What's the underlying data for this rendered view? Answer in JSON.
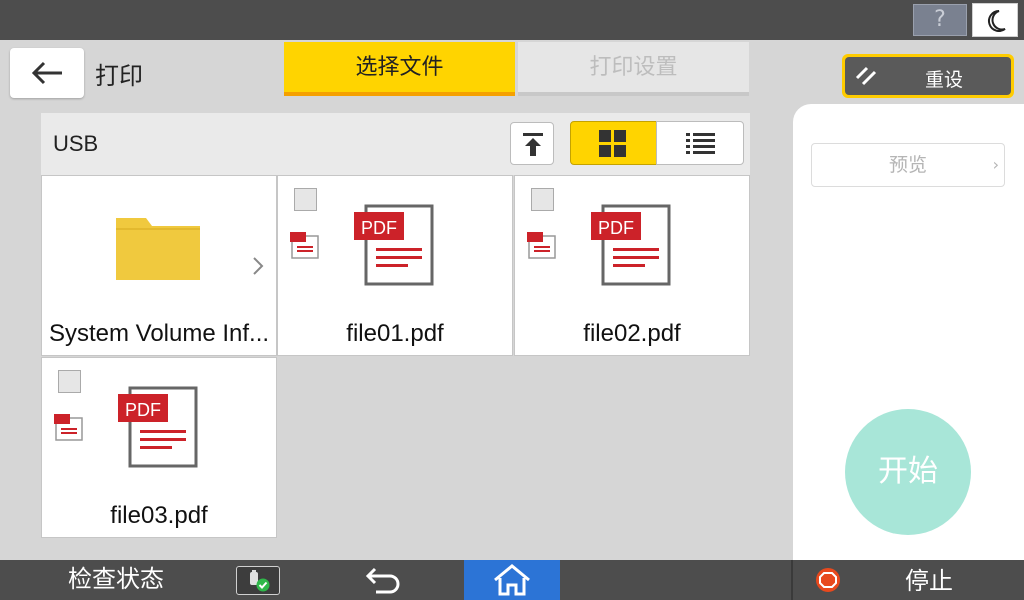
{
  "header": {
    "app_title": "打印",
    "help_label": "?",
    "tabs": [
      {
        "label": "选择文件",
        "active": true
      },
      {
        "label": "打印设置",
        "active": false
      }
    ],
    "reset_label": "重设"
  },
  "browser": {
    "location": "USB",
    "view_mode": "grid",
    "items": [
      {
        "name": "System Volume Inf...",
        "type": "folder"
      },
      {
        "name": "file01.pdf",
        "type": "pdf",
        "checked": false
      },
      {
        "name": "file02.pdf",
        "type": "pdf",
        "checked": false
      },
      {
        "name": "file03.pdf",
        "type": "pdf",
        "checked": false
      }
    ],
    "pdf_icon_label": "PDF"
  },
  "side": {
    "preview_label": "预览",
    "preview_arrow": "›",
    "start_label": "开始"
  },
  "footer": {
    "status_label": "检查状态",
    "stop_label": "停止"
  },
  "colors": {
    "accent_yellow": "#ffd400",
    "tab_underline": "#f5a000",
    "home_blue": "#2c74d6",
    "start_teal": "#a8e6d8",
    "pdf_red": "#cc2229",
    "folder_yellow": "#f0c93e",
    "bar_gray": "#4d4d4d"
  },
  "icons": [
    "help-icon",
    "moon-icon",
    "back-arrow-icon",
    "reset-icon",
    "upload-top-icon",
    "grid-view-icon",
    "list-view-icon",
    "folder-icon",
    "pdf-file-icon",
    "chevron-right-icon",
    "usb-status-icon",
    "undo-icon",
    "home-icon",
    "stop-icon"
  ]
}
